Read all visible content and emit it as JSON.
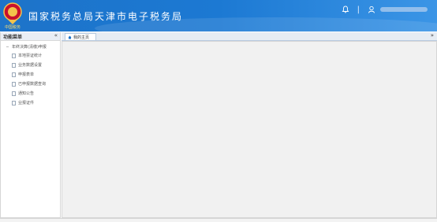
{
  "header": {
    "title": "国家税务总局天津市电子税务局",
    "emblem_text": "中国税务",
    "icons": [
      "bell-icon",
      "user-icon"
    ],
    "separator": "|"
  },
  "sidebar": {
    "title": "功能菜单",
    "collapse": "«",
    "root": "年终决算(清缴)申报",
    "items": [
      {
        "label": "本地票证统计"
      },
      {
        "label": "业务数据设置"
      },
      {
        "label": "申报表单"
      },
      {
        "label": "已申报数据查询"
      },
      {
        "label": "通知公告"
      },
      {
        "label": "业报证件"
      }
    ]
  },
  "tabs": [
    {
      "label": "我的主页"
    }
  ],
  "tab_more": "»",
  "colors": {
    "header": "#1d73c9",
    "content_bg": "#f1f1f1"
  }
}
